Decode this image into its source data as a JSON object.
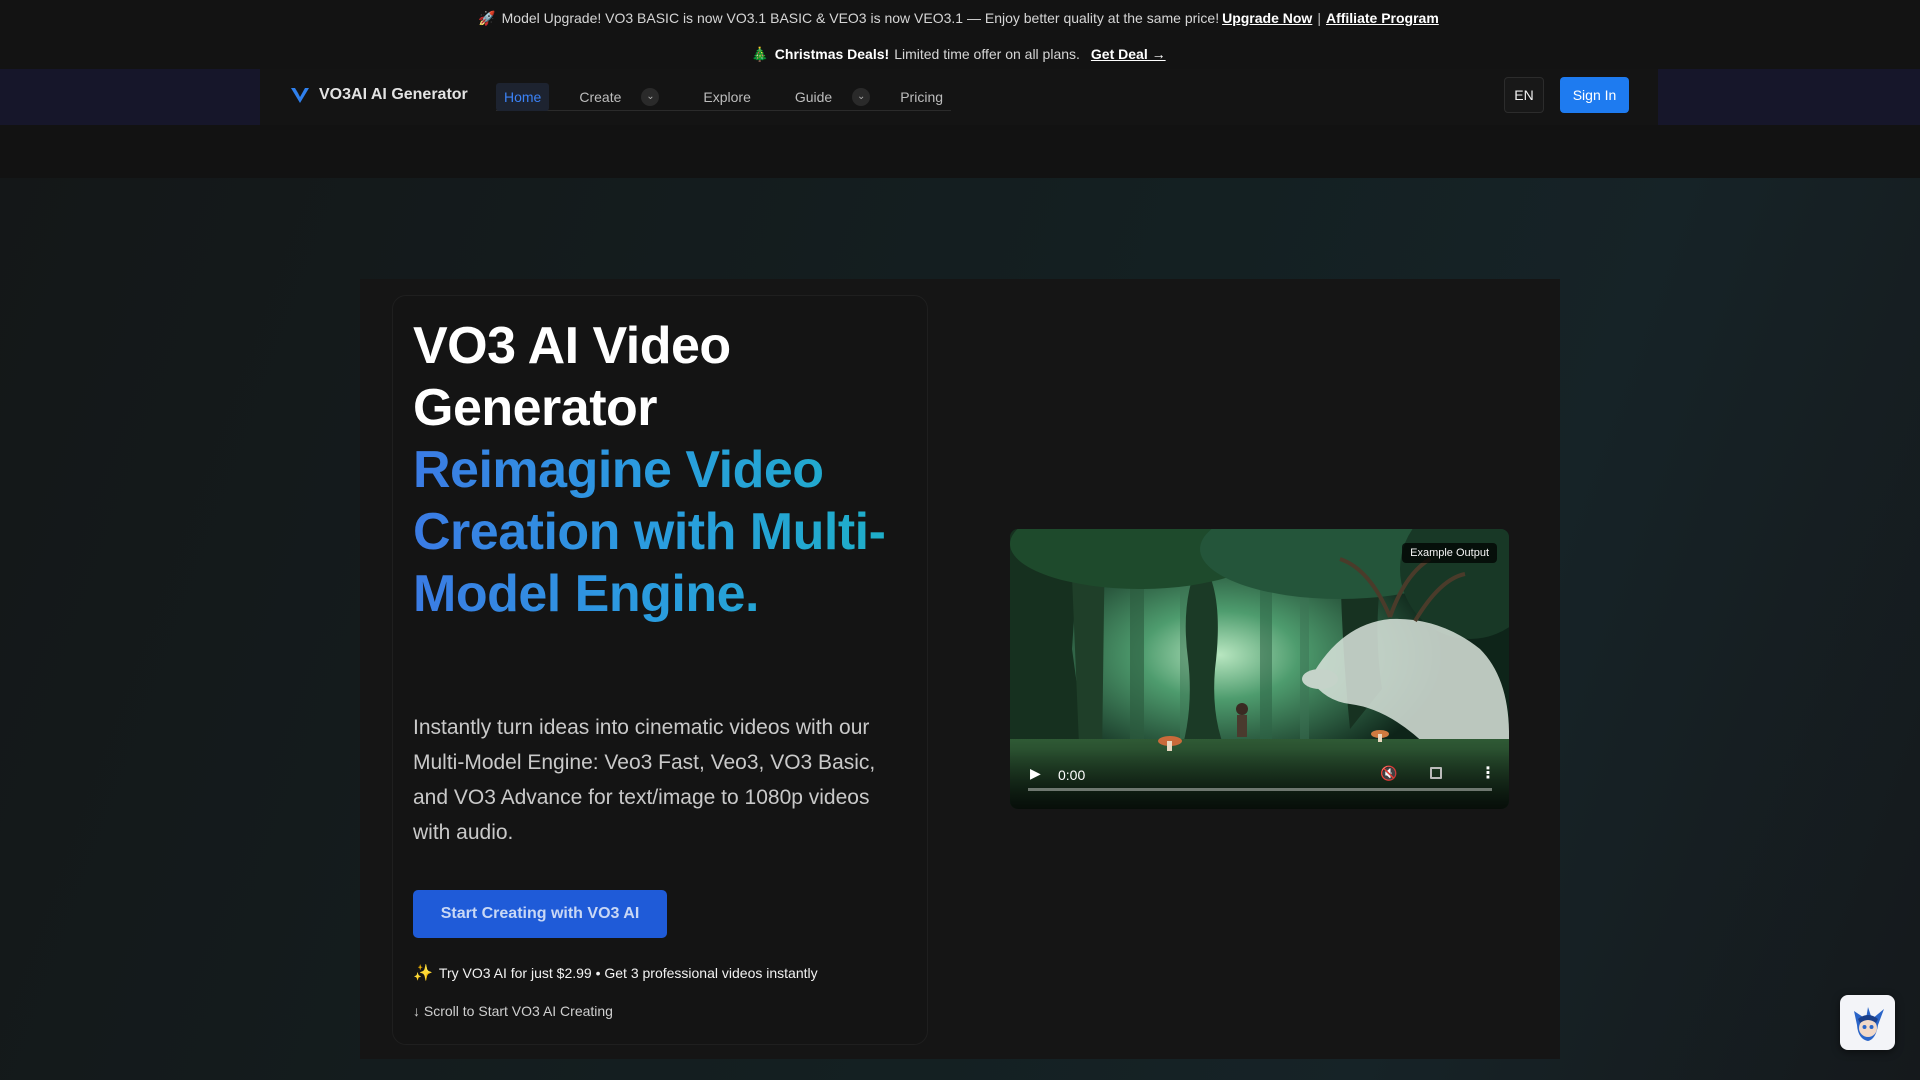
{
  "announcements": {
    "upgrade": {
      "icon": "rocket-icon",
      "text": "Model Upgrade! VO3 BASIC is now VO3.1 BASIC & VEO3 is now VEO3.1 — Enjoy better quality at the same price!",
      "link_upgrade": "Upgrade Now",
      "separator": "|",
      "link_affiliate": "Affiliate Program"
    },
    "deal": {
      "icon": "christmas-tree-icon",
      "bold": "Christmas Deals!",
      "text": "Limited time offer on all plans.",
      "link": "Get Deal →"
    }
  },
  "nav": {
    "brand": "VO3AI AI Generator",
    "links": {
      "home": "Home",
      "create": "Create",
      "explore": "Explore",
      "guide": "Guide",
      "pricing": "Pricing"
    },
    "language": "EN",
    "signin": "Sign In"
  },
  "hero": {
    "title_white": "VO3 AI Video Generator",
    "title_blue": "Reimagine Video Creation with Multi-Model Engine.",
    "description": "Instantly turn ideas into cinematic videos with our Multi-Model Engine: Veo3 Fast, Veo3, VO3 Basic, and VO3 Advance for text/image to 1080p videos with audio.",
    "cta": "Start Creating with VO3 AI",
    "offer": "Try VO3 AI for just $2.99 • Get 3 professional videos instantly",
    "offer_icon": "sparkles-icon",
    "scroll_hint": "↓ Scroll to Start VO3 AI Creating"
  },
  "video": {
    "tag": "Example Output",
    "time": "0:00",
    "progress": 0
  },
  "colors": {
    "accent": "#1e7bf0",
    "cta": "#1f5bd8",
    "gradient_start": "#3b7be4",
    "gradient_end": "#1db0c6"
  }
}
